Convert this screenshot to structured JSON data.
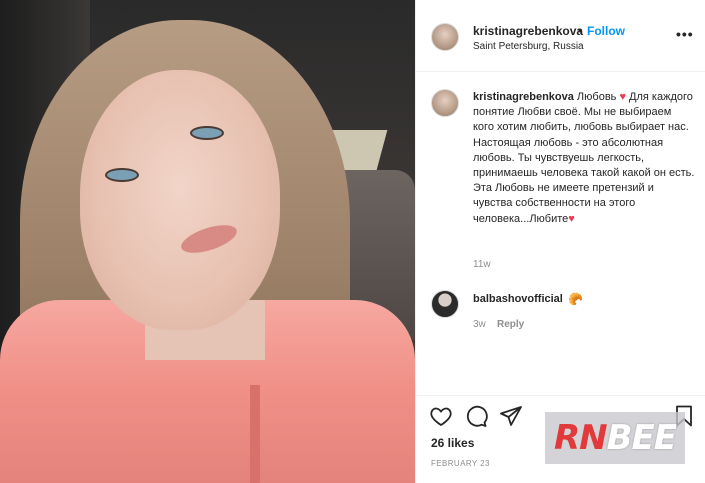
{
  "post": {
    "username": "kristinagrebenkova",
    "dot": "•",
    "follow_label": "Follow",
    "location": "Saint Petersburg, Russia",
    "more": "•••"
  },
  "caption": {
    "username": "kristinagrebenkova",
    "text_before_heart": " Любовь ",
    "text_after_heart": " Для каждого понятие Любви своё. Мы не выбираем кого хотим любить, любовь выбирает нас. Настоящая любовь - это абсолютная любовь. Ты чувствуешь легкость, принимаешь человека такой какой он есть. Эта Любовь не имеете претензий и чувства собственности на этого человека...Любите",
    "heart": "♥",
    "time": "11w"
  },
  "comment": {
    "username": "balbashovofficial",
    "emoji": "🥐",
    "time": "3w",
    "reply_label": "Reply"
  },
  "actions": {
    "like_icon": "heart-outline-icon",
    "comment_icon": "comment-bubble-icon",
    "share_icon": "paper-plane-icon",
    "save_icon": "bookmark-icon",
    "likes": "26 likes",
    "date": "FEBRUARY 23"
  },
  "watermark": {
    "part1": "RN",
    "part2": "BEE"
  },
  "colors": {
    "follow": "#0095f6",
    "heart": "#ed3c52",
    "secondary_text": "#8e8e8e",
    "primary_text": "#262626"
  }
}
